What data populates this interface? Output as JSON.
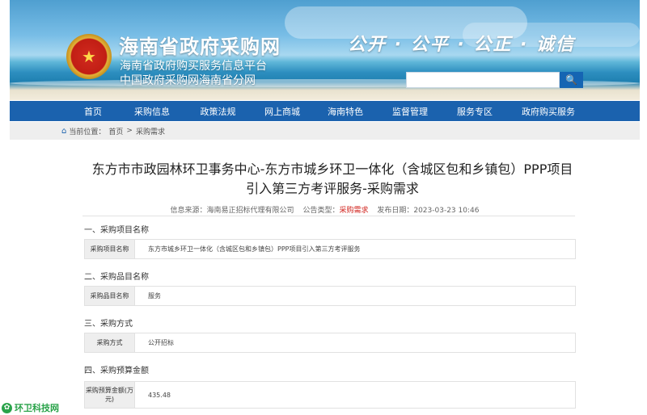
{
  "header": {
    "title": "海南省政府采购网",
    "subtitle1": "海南省政府购买服务信息平台",
    "subtitle2": "中国政府采购网海南省分网",
    "slogan": "公开 · 公平 · 公正 · 诚信",
    "search": {
      "placeholder": "",
      "icon": "search-icon"
    },
    "emblem_icon": "national-emblem-icon"
  },
  "nav": {
    "items": [
      "首页",
      "采购信息",
      "政策法规",
      "网上商城",
      "海南特色",
      "监督管理",
      "服务专区",
      "政府购买服务"
    ]
  },
  "breadcrumb": {
    "home_icon": "home-icon",
    "prefix": "当前位置：",
    "home": "首页",
    "sep": ">",
    "current": "采购需求"
  },
  "article": {
    "title": "东方市市政园林环卫事务中心-东方市城乡环卫一体化（含城区包和乡镇包）PPP项目引入第三方考评服务-采购需求",
    "meta": {
      "source_label": "信息来源：",
      "source": "海南易正招标代理有限公司",
      "type_label": "公告类型：",
      "type": "采购需求",
      "date_label": "发布日期：",
      "date": "2023-03-23 10:46"
    },
    "sections": [
      {
        "heading": "一、采购项目名称",
        "label": "采购项目名称",
        "value": "东方市城乡环卫一体化（含城区包和乡镇包）PPP项目引入第三方考评服务"
      },
      {
        "heading": "二、采购品目名称",
        "label": "采购品目名称",
        "value": "服务"
      },
      {
        "heading": "三、采购方式",
        "label": "采购方式",
        "value": "公开招标"
      },
      {
        "heading": "四、采购预算金额",
        "label": "采购预算金额(万元)",
        "value": "435.48"
      }
    ]
  },
  "watermark": {
    "text": "环卫科技网",
    "icon": "leaf-logo-icon"
  },
  "colors": {
    "nav": "#1b62ae",
    "accent_red": "#d0201a",
    "watermark": "#2aa34a"
  }
}
